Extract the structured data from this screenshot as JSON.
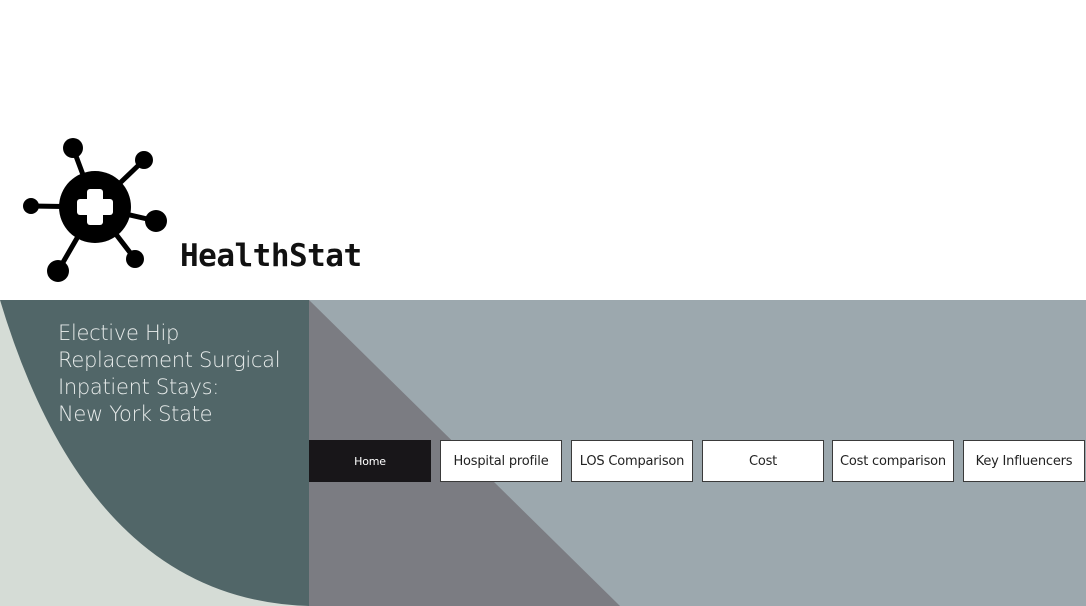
{
  "brand": {
    "name": "HealthStat",
    "logo_icon": "medical-molecule-cross-icon"
  },
  "hero": {
    "title_lines": [
      "Elective Hip",
      "Replacement Surgical",
      "Inpatient Stays:",
      "New York State"
    ]
  },
  "nav": {
    "items": [
      {
        "label": "Home",
        "active": true
      },
      {
        "label": "Hospital profile",
        "active": false
      },
      {
        "label": "LOS Comparison",
        "active": false
      },
      {
        "label": "Cost",
        "active": false
      },
      {
        "label": "Cost comparison",
        "active": false
      },
      {
        "label": "Key Influencers",
        "active": false
      }
    ]
  },
  "colors": {
    "panel_dark": "#516668",
    "panel_light_bg": "#d5dcd6",
    "triangle_gray": "#7b7c82",
    "hero_bg": "#9ca8ae",
    "active_nav": "#181619"
  }
}
